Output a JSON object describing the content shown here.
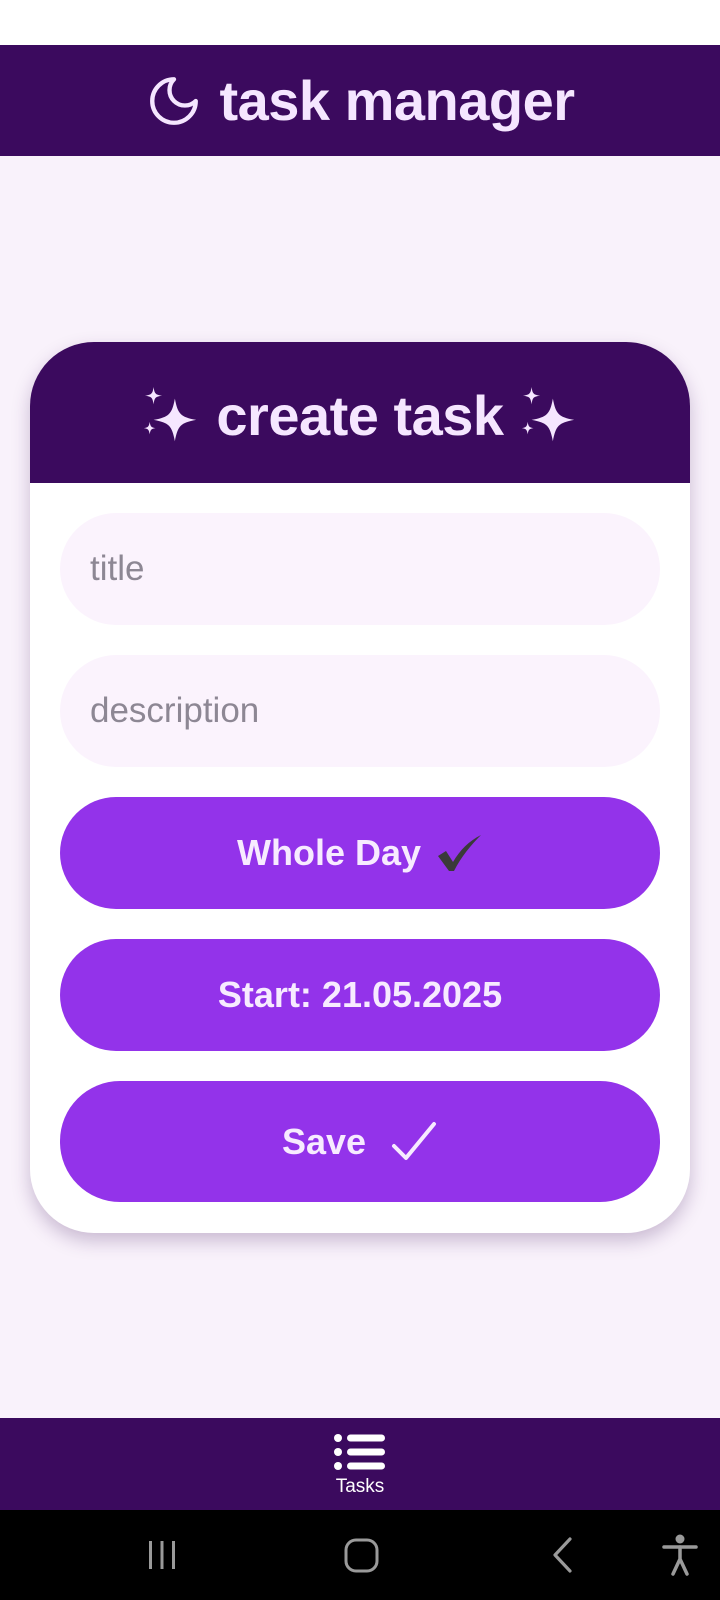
{
  "app": {
    "title": "task manager",
    "header_icon": "moon-icon"
  },
  "card": {
    "title": "create task",
    "title_icon": "sparkles-icon"
  },
  "form": {
    "title_placeholder": "title",
    "description_placeholder": "description",
    "whole_day_label": "Whole Day",
    "whole_day_checked": true,
    "start_label": "Start: 21.05.2025",
    "save_label": "Save"
  },
  "bottom_nav": {
    "items": [
      {
        "label": "Tasks",
        "icon": "list-icon",
        "active": true
      }
    ]
  },
  "system_nav": {
    "buttons": [
      "recent-apps-icon",
      "home-icon",
      "back-icon",
      "accessibility-icon"
    ]
  },
  "colors": {
    "header_bg": "#3b0a5e",
    "accent": "#9333ea",
    "page_bg": "#f9f2fb",
    "field_bg": "#fbf3fd",
    "header_text": "#f5e6ff"
  }
}
